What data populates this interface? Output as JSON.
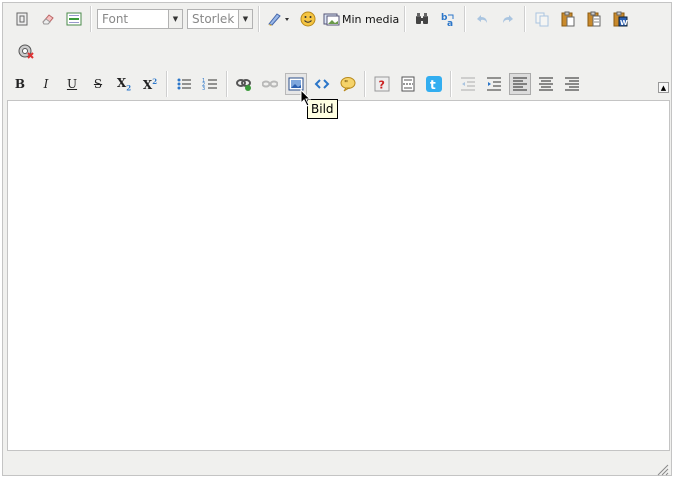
{
  "toolbar1": {
    "font_select": {
      "value": "Font"
    },
    "size_select": {
      "value": "Storlek"
    },
    "media_button_label": "Min media"
  },
  "tooltip": {
    "text": "Bild"
  },
  "colors": {
    "toolbar_bg": "#f0f0ee",
    "border": "#c4c4c4",
    "icon_blue": "#2b76c9",
    "icon_yellow": "#e9b42c",
    "twitter_blue": "#33aef0",
    "tooltip_bg": "#ffffe1"
  },
  "icons": {
    "row1": [
      "template-icon",
      "eraser-icon",
      "horizontal-rule-icon",
      "font-select",
      "size-select",
      "style-brush-icon",
      "emoticon-icon",
      "media-icon",
      "find-icon",
      "replace-icon",
      "undo-icon",
      "redo-icon",
      "copy-icon",
      "paste-icon",
      "paste-text-icon",
      "paste-word-icon"
    ],
    "row2": [
      "spellcheck-icon"
    ],
    "row3": [
      "bold-icon",
      "italic-icon",
      "underline-icon",
      "strikethrough-icon",
      "subscript-icon",
      "superscript-icon",
      "bullet-list-icon",
      "numbered-list-icon",
      "link-icon",
      "unlink-icon",
      "image-icon",
      "code-icon",
      "quote-icon",
      "help-icon",
      "page-break-icon",
      "twitter-icon",
      "outdent-icon",
      "indent-icon",
      "align-left-icon",
      "align-center-icon",
      "align-right-icon"
    ]
  }
}
